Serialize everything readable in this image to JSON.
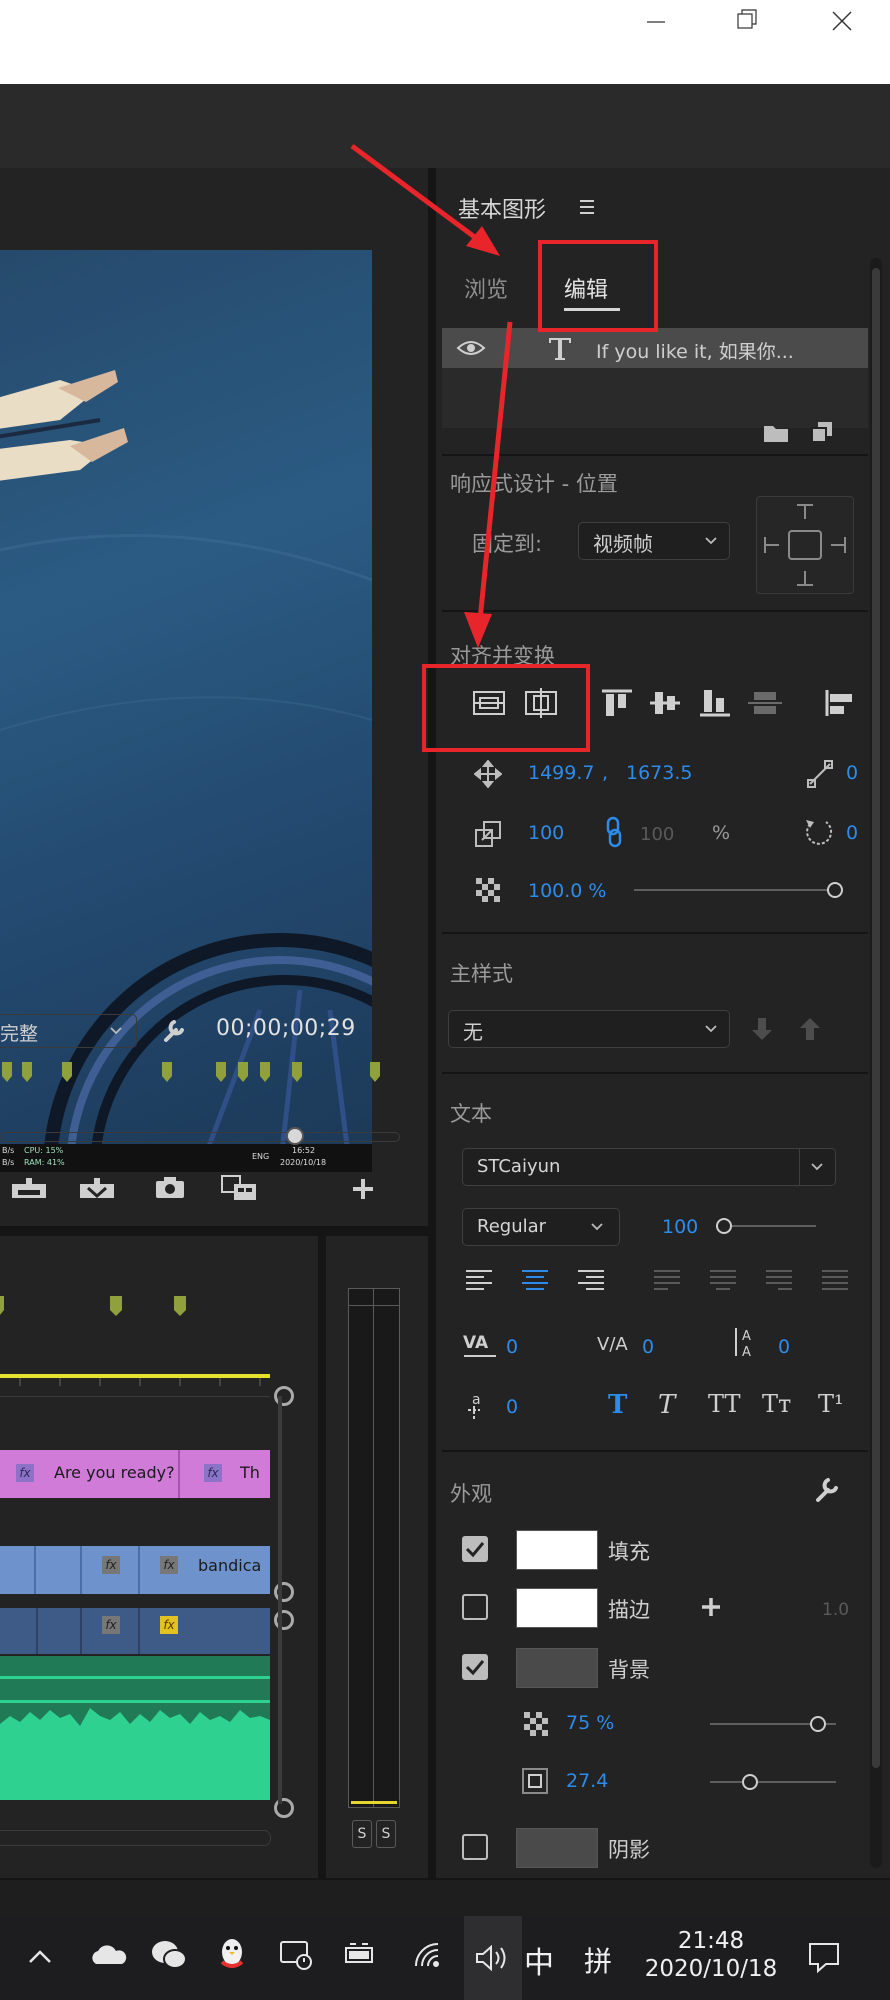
{
  "window": {
    "minimize_icon": "minimize-icon",
    "restore_icon": "restore-icon",
    "close_icon": "close-icon"
  },
  "panel": {
    "title": "基本图形",
    "tabs": [
      {
        "label": "浏览",
        "active": false
      },
      {
        "label": "编辑",
        "active": true
      }
    ],
    "layer": {
      "name": "If you like it, 如果你..."
    },
    "responsive": {
      "heading": "响应式设计 - 位置",
      "pin_label": "固定到:",
      "pin_value": "视频帧"
    },
    "align": {
      "heading": "对齐并变换"
    },
    "transform": {
      "pos_x": "1499.7",
      "pos_comma": ",",
      "pos_y": "1673.5",
      "pos_extra": "0",
      "scale": "100",
      "scale_h": "100",
      "scale_unit": "%",
      "rot_extra": "0",
      "opacity": "100.0 %",
      "opacity_level": 1.0
    },
    "master": {
      "heading": "主样式",
      "value": "无"
    },
    "text": {
      "heading": "文本",
      "font": "STCaiyun",
      "style": "Regular",
      "size": "100",
      "size_level": 0.0,
      "tracking": "0",
      "kerning": "0",
      "leading": "0",
      "baseline": "0",
      "styles": [
        "T",
        "T",
        "TT",
        "Tт",
        "T¹"
      ]
    },
    "appearance": {
      "heading": "外观",
      "fill": {
        "label": "填充",
        "checked": true,
        "color": "#ffffff"
      },
      "stroke": {
        "label": "描边",
        "checked": false,
        "color": "#ffffff",
        "value": "1.0"
      },
      "background": {
        "label": "背景",
        "checked": true,
        "color": "#4a4a4a",
        "opacity": "75 %",
        "opacity_level": 0.82,
        "size": "27.4",
        "size_level": 0.27
      },
      "shadow": {
        "label": "阴影",
        "checked": false,
        "color": "#4a4a4a"
      }
    }
  },
  "program": {
    "fit": "完整",
    "timecode": "00;00;00;29",
    "playback_position": 0.85,
    "screen_overlay": {
      "net1": "B/s",
      "net2": "B/s",
      "cpu": "CPU: 15%",
      "ram": "RAM: 41%",
      "lang": "ENG",
      "time": "16:52",
      "date": "2020/10/18"
    }
  },
  "timeline": {
    "clips": [
      {
        "label": "Are you ready?",
        "fx": "fx"
      },
      {
        "label": "Th",
        "fx": "fx"
      },
      {
        "label": "bandica",
        "fx": "fx"
      }
    ],
    "fx": "fx"
  },
  "meter": {
    "solo1": "S",
    "solo2": "S"
  },
  "taskbar": {
    "time": "21:48",
    "date": "2020/10/18",
    "ime1": "中",
    "ime2": "拼"
  },
  "colors": {
    "accent": "#2d8ceb",
    "annotation": "#e8252a",
    "clip_pink": "#d07bd8",
    "clip_blue": "#6e93cc",
    "audio_green": "#2fd191",
    "marker": "#8fa03c"
  }
}
